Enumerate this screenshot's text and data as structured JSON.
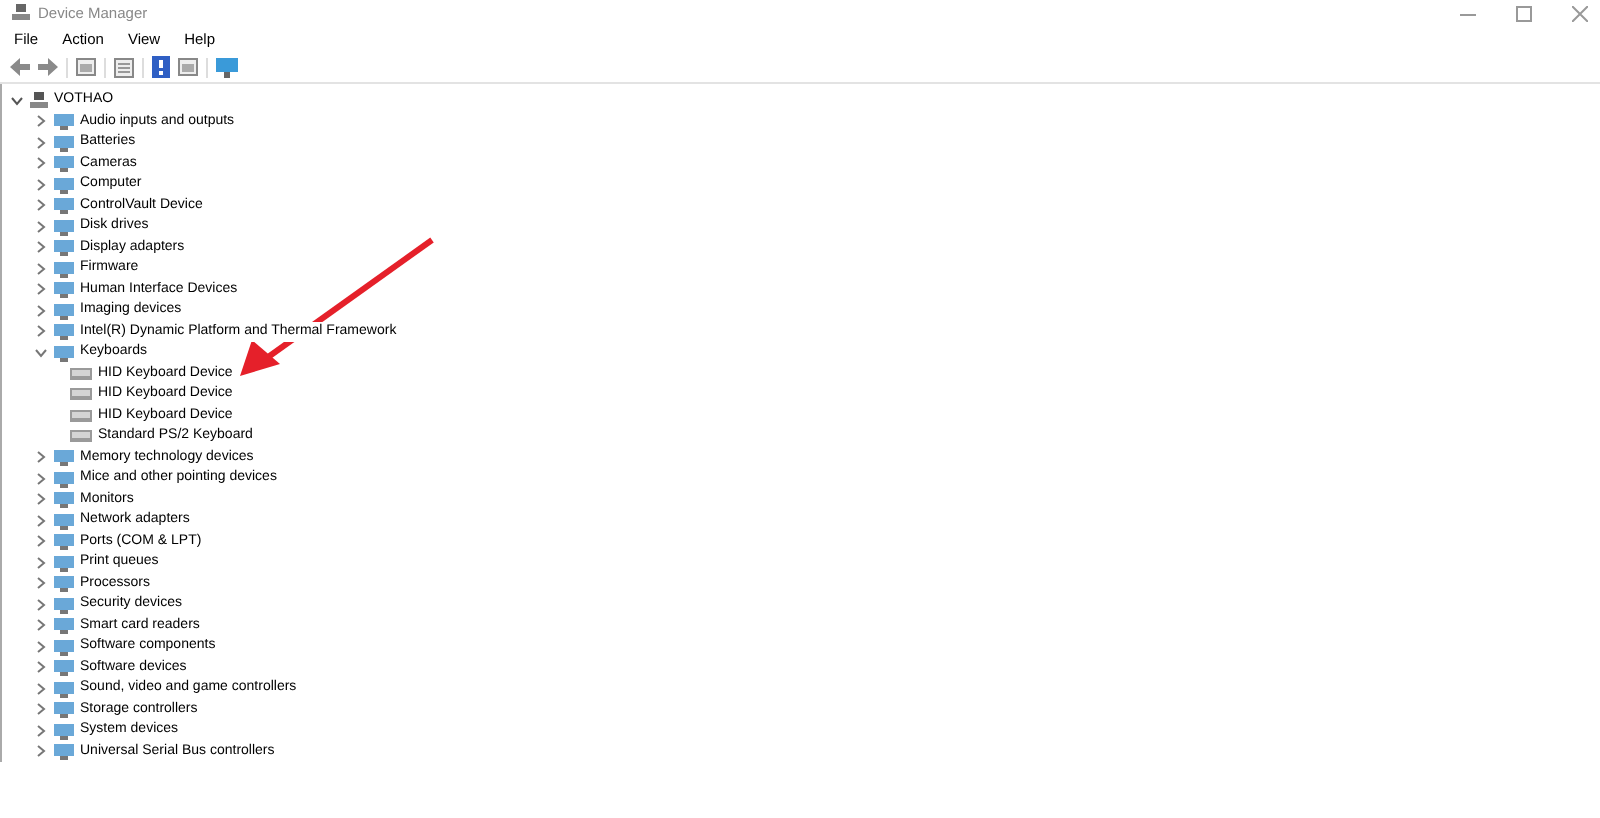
{
  "window": {
    "title": "Device Manager"
  },
  "menu": [
    "File",
    "Action",
    "View",
    "Help"
  ],
  "tree": {
    "label": "VOTHAO",
    "expanded": true,
    "children": [
      {
        "label": "Audio inputs and outputs",
        "expanded": false
      },
      {
        "label": "Batteries",
        "expanded": false
      },
      {
        "label": "Cameras",
        "expanded": false
      },
      {
        "label": "Computer",
        "expanded": false
      },
      {
        "label": "ControlVault Device",
        "expanded": false
      },
      {
        "label": "Disk drives",
        "expanded": false
      },
      {
        "label": "Display adapters",
        "expanded": false
      },
      {
        "label": "Firmware",
        "expanded": false
      },
      {
        "label": "Human Interface Devices",
        "expanded": false
      },
      {
        "label": "Imaging devices",
        "expanded": false
      },
      {
        "label": "Intel(R) Dynamic Platform and Thermal Framework",
        "expanded": false
      },
      {
        "label": "Keyboards",
        "expanded": true,
        "children": [
          {
            "label": "HID Keyboard Device"
          },
          {
            "label": "HID Keyboard Device"
          },
          {
            "label": "HID Keyboard Device"
          },
          {
            "label": "Standard PS/2 Keyboard"
          }
        ]
      },
      {
        "label": "Memory technology devices",
        "expanded": false
      },
      {
        "label": "Mice and other pointing devices",
        "expanded": false
      },
      {
        "label": "Monitors",
        "expanded": false
      },
      {
        "label": "Network adapters",
        "expanded": false
      },
      {
        "label": "Ports (COM & LPT)",
        "expanded": false
      },
      {
        "label": "Print queues",
        "expanded": false
      },
      {
        "label": "Processors",
        "expanded": false
      },
      {
        "label": "Security devices",
        "expanded": false
      },
      {
        "label": "Smart card readers",
        "expanded": false
      },
      {
        "label": "Software components",
        "expanded": false
      },
      {
        "label": "Software devices",
        "expanded": false
      },
      {
        "label": "Sound, video and game controllers",
        "expanded": false
      },
      {
        "label": "Storage controllers",
        "expanded": false
      },
      {
        "label": "System devices",
        "expanded": false
      },
      {
        "label": "Universal Serial Bus controllers",
        "expanded": false
      }
    ]
  }
}
